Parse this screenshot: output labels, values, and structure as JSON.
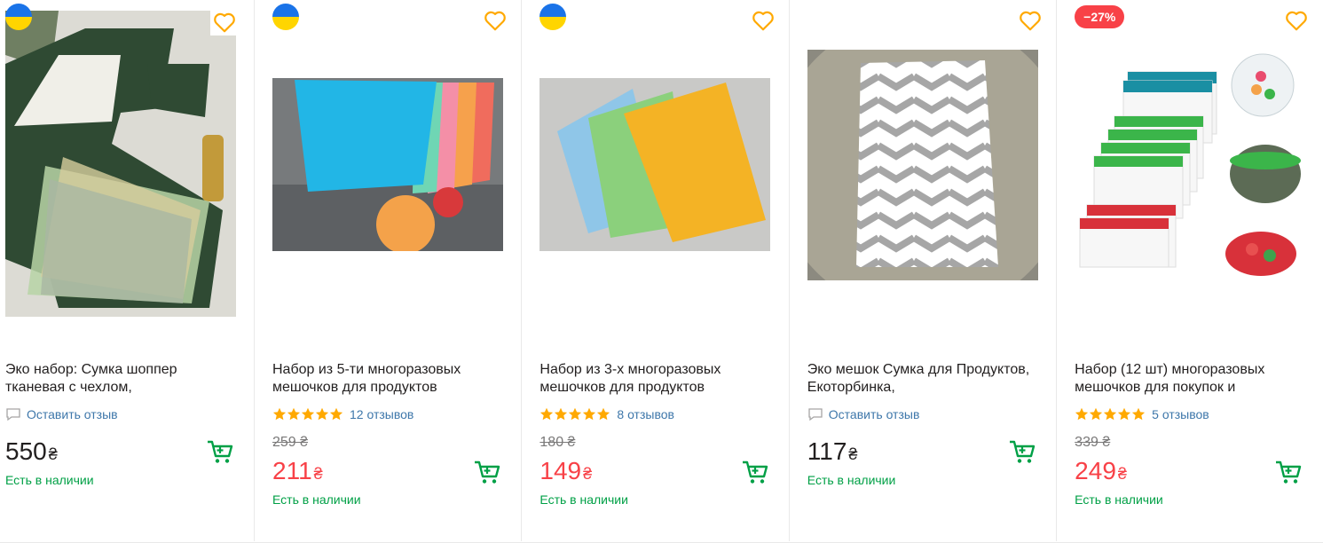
{
  "products": [
    {
      "title": "Эко набор: Сумка шоппер тканевая с чехлом,",
      "review_text": "Оставить отзыв",
      "price": "550",
      "currency": "₴",
      "availability": "Есть в наличии",
      "flag": "ukraine-flag-icon",
      "favorite_icon": "heart-icon",
      "cart_icon": "cart-icon"
    },
    {
      "title": "Набор из 5-ти многоразовых мешочков для продуктов",
      "rating_stars": 5,
      "review_text": "12 отзывов",
      "old_price": "259 ₴",
      "price": "211",
      "currency": "₴",
      "availability": "Есть в наличии",
      "flag": "ukraine-flag-icon"
    },
    {
      "title": "Набор из 3-х многоразовых мешочков для продуктов",
      "rating_stars": 5,
      "review_text": "8 отзывов",
      "old_price": "180 ₴",
      "price": "149",
      "currency": "₴",
      "availability": "Есть в наличии",
      "flag": "ukraine-flag-icon"
    },
    {
      "title": "Эко мешок Сумка для Продуктов, Екоторбинка,",
      "review_text": "Оставить отзыв",
      "price": "117",
      "currency": "₴",
      "availability": "Есть в наличии"
    },
    {
      "title": "Набор (12 шт) многоразовых мешочков для покупок и",
      "rating_stars": 5,
      "review_text": "5 отзывов",
      "old_price": "339 ₴",
      "price": "249",
      "currency": "₴",
      "availability": "Есть в наличии",
      "discount_badge": "−27%"
    }
  ],
  "colors": {
    "accent_orange": "#ffa900",
    "cart_green": "#00a046",
    "sale_red": "#f84147",
    "link_blue": "#3e77aa"
  }
}
